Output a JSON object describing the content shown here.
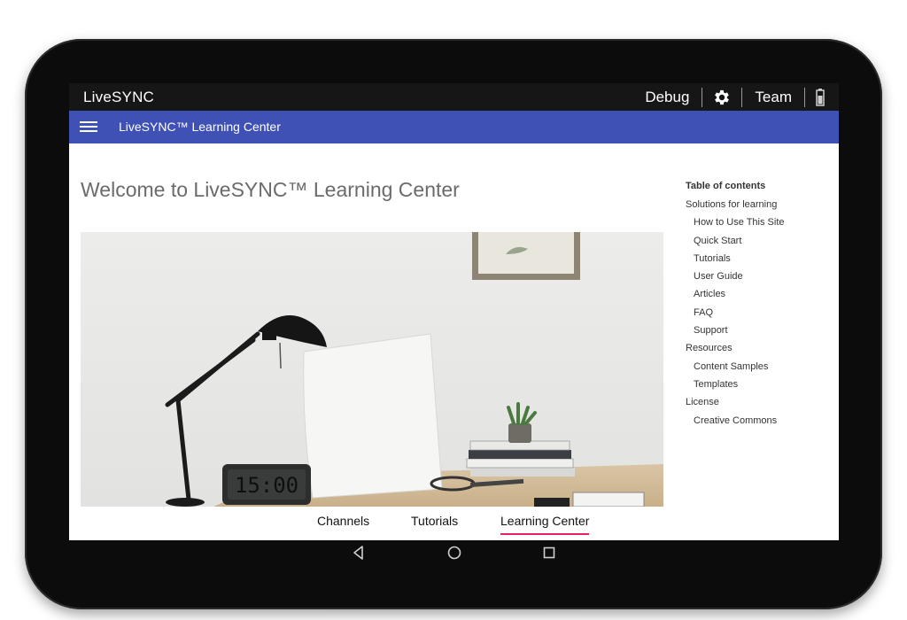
{
  "topbar": {
    "brand": "LiveSYNC",
    "debug_label": "Debug",
    "team_label": "Team",
    "gear_icon": "gear-icon",
    "battery_icon": "battery-icon"
  },
  "appbar": {
    "menu_icon": "hamburger-menu-icon",
    "title": "LiveSYNC™ Learning Center",
    "color": "#3f51b5"
  },
  "main": {
    "title": "Welcome to LiveSYNC™ Learning Center"
  },
  "toc": {
    "title": "Table of contents",
    "items": [
      {
        "label": "Solutions for learning",
        "level": 1
      },
      {
        "label": "How to Use This Site",
        "level": 2
      },
      {
        "label": "Quick Start",
        "level": 2
      },
      {
        "label": "Tutorials",
        "level": 2
      },
      {
        "label": "User Guide",
        "level": 2
      },
      {
        "label": "Articles",
        "level": 2
      },
      {
        "label": "FAQ",
        "level": 2
      },
      {
        "label": "Support",
        "level": 2
      },
      {
        "label": "Resources",
        "level": 1
      },
      {
        "label": "Content Samples",
        "level": 2
      },
      {
        "label": "Templates",
        "level": 2
      },
      {
        "label": "License",
        "level": 1
      },
      {
        "label": "Creative Commons",
        "level": 2
      }
    ]
  },
  "hero": {
    "clock_text": "15:00"
  },
  "tabs": {
    "items": [
      "Channels",
      "Tutorials",
      "Learning Center"
    ],
    "active": "Learning Center",
    "accent": "#e91e63"
  },
  "navbar": {
    "back_icon": "back-triangle-icon",
    "home_icon": "home-circle-icon",
    "recents_icon": "recents-square-icon"
  }
}
